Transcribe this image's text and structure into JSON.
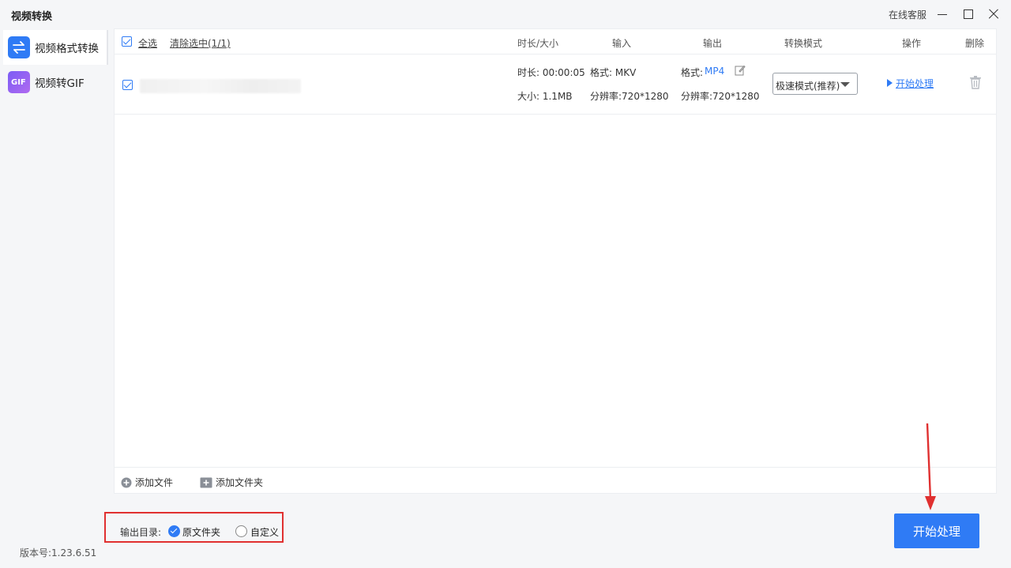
{
  "window": {
    "title": "视频转换",
    "online_service": "在线客服"
  },
  "sidebar": {
    "items": [
      {
        "label": "视频格式转换",
        "icon": "convert-arrows-icon",
        "active": true
      },
      {
        "label": "视频转GIF",
        "icon": "gif-icon",
        "active": false
      }
    ]
  },
  "header": {
    "select_all": "全选",
    "clear_selected": "清除选中(1/1)",
    "col_duration_size": "时长/大小",
    "col_input": "输入",
    "col_output": "输出",
    "col_mode": "转换模式",
    "col_action": "操作",
    "col_delete": "删除"
  },
  "file": {
    "checked": true,
    "duration": "时长: 00:00:05",
    "size": "大小: 1.1MB",
    "input_format": "格式: MKV",
    "input_resolution": "分辨率:720*1280",
    "output_format_label": "格式:",
    "output_format_value": "MP4",
    "output_resolution": "分辨率:720*1280",
    "mode": "极速模式(推荐)",
    "start_link": "开始处理"
  },
  "footer": {
    "add_file": "添加文件",
    "add_folder": "添加文件夹"
  },
  "output": {
    "label": "输出目录:",
    "option_original": "原文件夹",
    "option_custom": "自定义",
    "selected": "原文件夹"
  },
  "version": "版本号:1.23.6.51",
  "start_button": "开始处理",
  "colors": {
    "accent": "#2f7bf5",
    "highlight_box": "#e03030"
  }
}
